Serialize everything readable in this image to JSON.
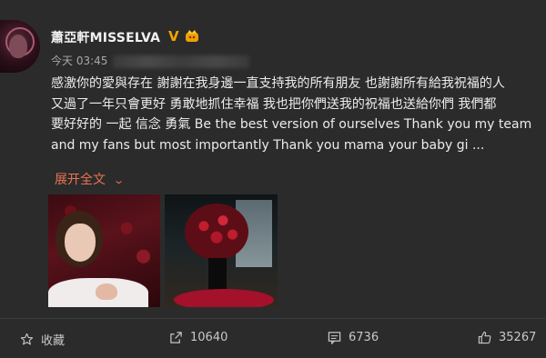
{
  "post": {
    "username": "蕭亞軒MISSELVA",
    "verified_badge": "V",
    "timestamp": "今天 03:45",
    "lines": [
      "感激你的愛與存在 謝謝在我身邊一直支持我的所有朋友 也謝謝所有給我祝福的人",
      "又過了一年只會更好 勇敢地抓住幸福 我也把你們送我的祝福也送給你們 我們都",
      "要好好的  一起 信念 勇氣 Be the best version of ourselves Thank you my team",
      "and my fans but most importantly Thank you mama your baby gi ..."
    ],
    "expand_label": "展开全文",
    "expand_icon": "chevron-down-icon"
  },
  "actions": {
    "favorite_label": "收藏",
    "share_count": "10640",
    "comment_count": "6736",
    "like_count": "35267"
  },
  "colors": {
    "background": "#2b2b2b",
    "accent_link": "#eb7350",
    "verified": "#f5a300"
  }
}
